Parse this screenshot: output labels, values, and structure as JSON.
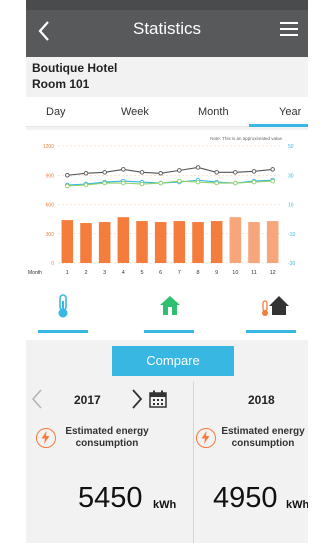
{
  "header": {
    "title": "Statistics"
  },
  "hotel": {
    "name": "Boutique Hotel",
    "room": "Room 101"
  },
  "tabs": {
    "items": [
      "Day",
      "Week",
      "Month",
      "Year"
    ],
    "active": "Year"
  },
  "chart_data": {
    "type": "bar",
    "note": "Note: This is an approximated value",
    "xlabel": "Month",
    "categories": [
      "1",
      "2",
      "3",
      "4",
      "5",
      "6",
      "7",
      "8",
      "9",
      "10",
      "11",
      "12"
    ],
    "left_axis": {
      "ticks": [
        "1200",
        "900",
        "600",
        "300",
        "0"
      ],
      "ylim": [
        0,
        1200
      ]
    },
    "right_axis": {
      "ticks": [
        "50",
        "30",
        "10",
        "-10",
        "-30"
      ],
      "ylim": [
        -30,
        50
      ]
    },
    "series": [
      {
        "values": [
          440,
          410,
          420,
          470,
          430,
          420,
          430,
          420,
          430,
          470,
          420,
          430
        ],
        "color": "#f47c3c"
      },
      {
        "values": [
          900,
          920,
          930,
          960,
          930,
          920,
          950,
          980,
          930,
          930,
          940,
          960
        ],
        "color": "#555555"
      },
      {
        "values": [
          800,
          810,
          830,
          840,
          830,
          820,
          830,
          850,
          830,
          820,
          840,
          850
        ],
        "color": "#39b7e3"
      },
      {
        "values": [
          790,
          800,
          820,
          820,
          810,
          820,
          840,
          830,
          820,
          820,
          830,
          840
        ],
        "color": "#8fd16a"
      }
    ],
    "grid": true
  },
  "icon_tabs": {
    "items": [
      {
        "name": "thermometer-icon",
        "color": "#39b7e3"
      },
      {
        "name": "home-icon",
        "color": "#2fbf71"
      },
      {
        "name": "home-temperature-icon",
        "color": "#333333"
      }
    ]
  },
  "compare": {
    "label": "Compare"
  },
  "panel_left": {
    "year": "2017",
    "label": "Estimated energy consumption",
    "value": "5450",
    "unit": "kWh"
  },
  "panel_right": {
    "year": "2018",
    "label": "Estimated energy consumption",
    "value": "4950",
    "unit": "kWh"
  }
}
